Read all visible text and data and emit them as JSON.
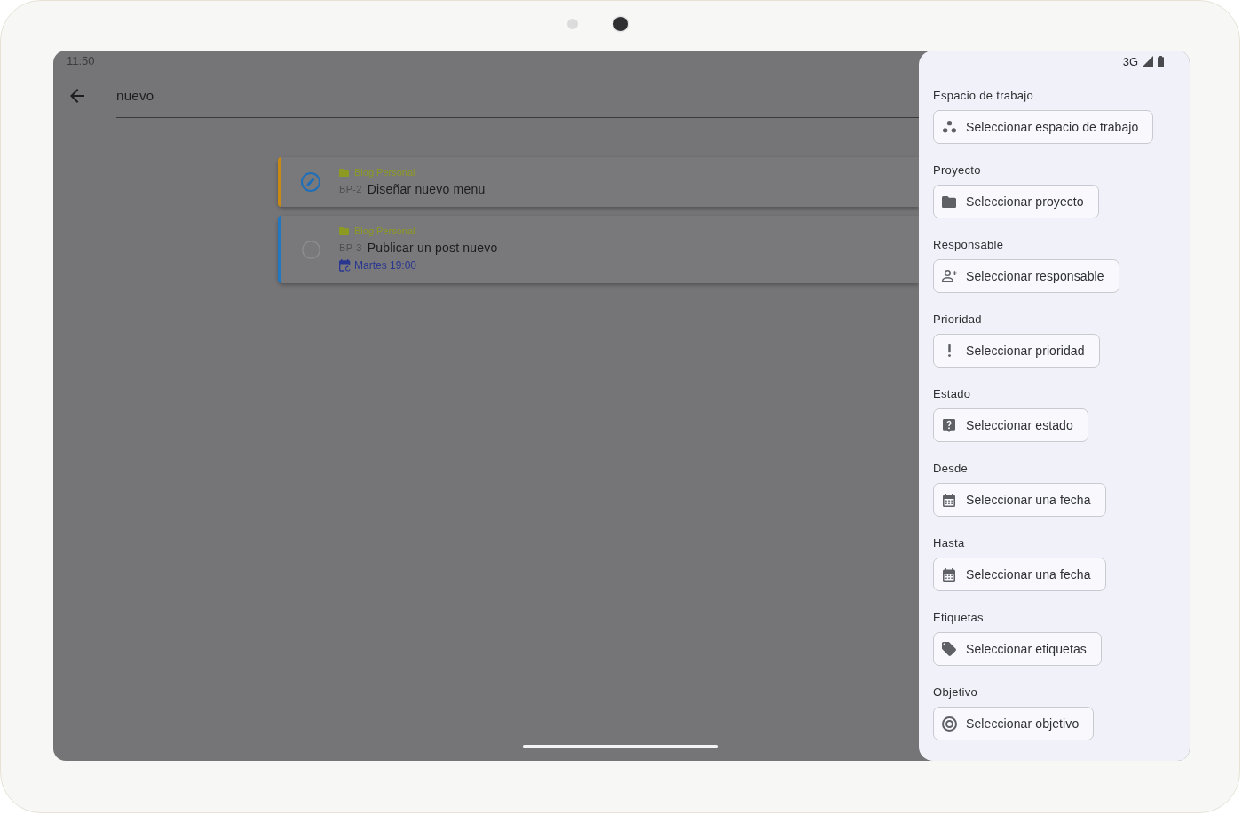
{
  "status_bar": {
    "time": "11:50",
    "network": "3G"
  },
  "search": {
    "value": "nuevo"
  },
  "tasks": [
    {
      "kind": "in_progress",
      "color": "#c98a14",
      "project": "Blog Personal",
      "key": "BP-2",
      "title": "Diseñar nuevo menu"
    },
    {
      "kind": "todo",
      "color": "#1f78c1",
      "project": "Blog Personal",
      "key": "BP-3",
      "title": "Publicar un post nuevo",
      "due": "Martes 19:00"
    }
  ],
  "filter_panel": {
    "sections": [
      {
        "label": "Espacio de trabajo",
        "kind": "workspace",
        "button": "Seleccionar espacio de trabajo"
      },
      {
        "label": "Proyecto",
        "kind": "project",
        "button": "Seleccionar proyecto"
      },
      {
        "label": "Responsable",
        "kind": "assignee",
        "button": "Seleccionar responsable"
      },
      {
        "label": "Prioridad",
        "kind": "priority",
        "button": "Seleccionar prioridad"
      },
      {
        "label": "Estado",
        "kind": "status",
        "button": "Seleccionar estado"
      },
      {
        "label": "Desde",
        "kind": "date",
        "button": "Seleccionar una fecha"
      },
      {
        "label": "Hasta",
        "kind": "date",
        "button": "Seleccionar una fecha"
      },
      {
        "label": "Etiquetas",
        "kind": "tags",
        "button": "Seleccionar etiquetas"
      },
      {
        "label": "Objetivo",
        "kind": "goal",
        "button": "Seleccionar objetivo"
      }
    ]
  }
}
